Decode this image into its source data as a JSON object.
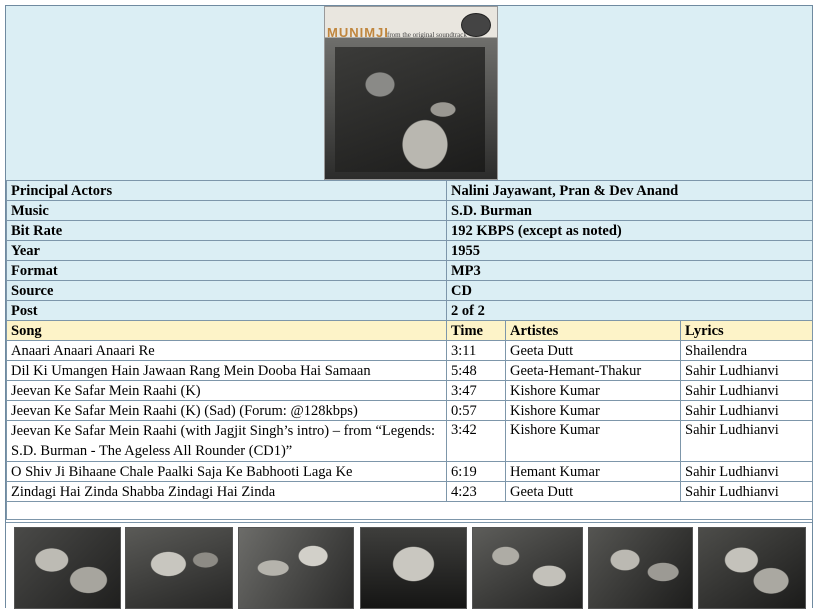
{
  "cover": {
    "title": "MUNIMJI",
    "subtitle": "from the original soundtrack",
    "image": "album-cover-image"
  },
  "details": [
    {
      "label": "Principal Actors",
      "value": "Nalini Jayawant, Pran & Dev Anand"
    },
    {
      "label": "Music",
      "value": "S.D. Burman"
    },
    {
      "label": "Bit Rate",
      "value": "192 KBPS (except as noted)"
    },
    {
      "label": "Year",
      "value": "1955"
    },
    {
      "label": "Format",
      "value": "MP3"
    },
    {
      "label": "Source",
      "value": "CD"
    },
    {
      "label": "Post",
      "value": "2 of 2"
    }
  ],
  "columns": {
    "song": "Song",
    "time": "Time",
    "artistes": "Artistes",
    "lyrics": "Lyrics"
  },
  "songs": [
    {
      "song": "Anaari Anaari Anaari Re",
      "time": "3:11",
      "artistes": "Geeta Dutt",
      "lyrics": "Shailendra"
    },
    {
      "song": "Dil Ki Umangen Hain Jawaan Rang Mein Dooba Hai Samaan",
      "time": "5:48",
      "artistes": "Geeta-Hemant-Thakur",
      "lyrics": "Sahir Ludhianvi"
    },
    {
      "song": "Jeevan Ke Safar Mein Raahi (K)",
      "time": "3:47",
      "artistes": "Kishore Kumar",
      "lyrics": "Sahir Ludhianvi"
    },
    {
      "song": "Jeevan Ke Safar Mein Raahi (K) (Sad) (Forum: @128kbps)",
      "time": "0:57",
      "artistes": "Kishore Kumar",
      "lyrics": "Sahir Ludhianvi"
    },
    {
      "song": "Jeevan Ke Safar Mein Raahi (with Jagjit Singh’s intro) – from “Legends: S.D. Burman - The Ageless All Rounder (CD1)”",
      "time": "3:42",
      "artistes": "Kishore Kumar",
      "lyrics": "Sahir Ludhianvi"
    },
    {
      "song": "O Shiv Ji Bihaane Chale Paalki Saja Ke Babhooti Laga Ke",
      "time": "6:19",
      "artistes": "Hemant Kumar",
      "lyrics": "Sahir Ludhianvi"
    },
    {
      "song": "Zindagi Hai Zinda Shabba Zindagi Hai Zinda",
      "time": "4:23",
      "artistes": "Geeta Dutt",
      "lyrics": "Sahir Ludhianvi"
    }
  ],
  "photos": [
    "film-still-1",
    "film-still-2",
    "film-still-3",
    "film-still-4",
    "film-still-5",
    "film-still-6",
    "film-still-7"
  ]
}
